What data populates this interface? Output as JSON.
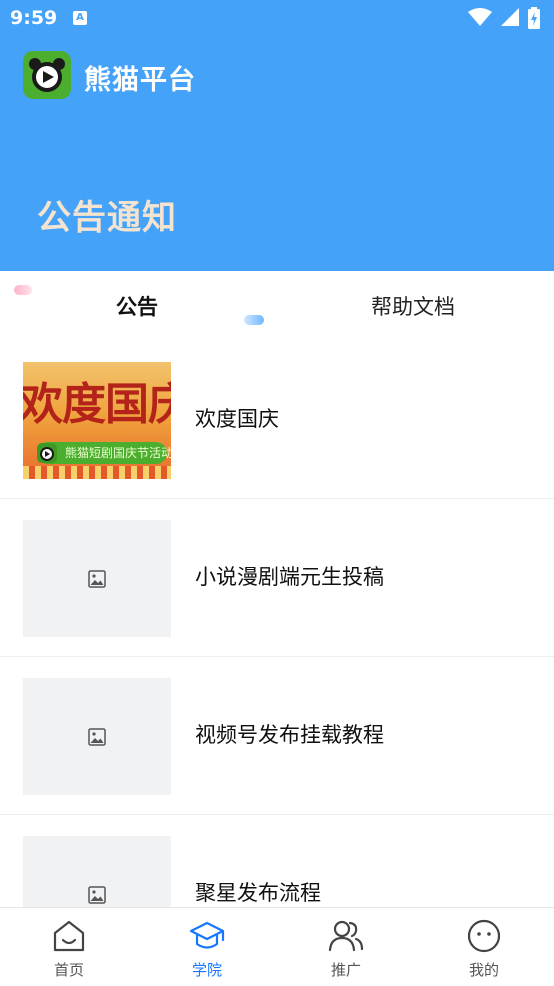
{
  "status_bar": {
    "time": "9:59",
    "indicator_letter": "A"
  },
  "header": {
    "app_title": "熊猫平台",
    "page_heading": "公告通知"
  },
  "tabs": [
    {
      "label": "公告",
      "active": true
    },
    {
      "label": "帮助文档",
      "active": false
    }
  ],
  "list": [
    {
      "title": "欢度国庆",
      "thumbnail": "banner",
      "banner_text": "欢度国庆",
      "banner_subtitle": "熊猫短剧国庆节活动"
    },
    {
      "title": "小说漫剧端元生投稿",
      "thumbnail": "image-placeholder-icon"
    },
    {
      "title": "视频号发布挂载教程",
      "thumbnail": "image-placeholder-icon"
    },
    {
      "title": "聚星发布流程",
      "thumbnail": "image-placeholder-icon"
    }
  ],
  "bottom_nav": [
    {
      "label": "首页",
      "icon": "home-icon",
      "active": false
    },
    {
      "label": "学院",
      "icon": "graduation-cap-icon",
      "active": true
    },
    {
      "label": "推广",
      "icon": "users-icon",
      "active": false
    },
    {
      "label": "我的",
      "icon": "smiley-icon",
      "active": false
    }
  ],
  "colors": {
    "header_bg": "#45a2f9",
    "accent": "#1677ff",
    "heading_text": "#f4e3cf",
    "logo_green": "#4cae2e"
  }
}
